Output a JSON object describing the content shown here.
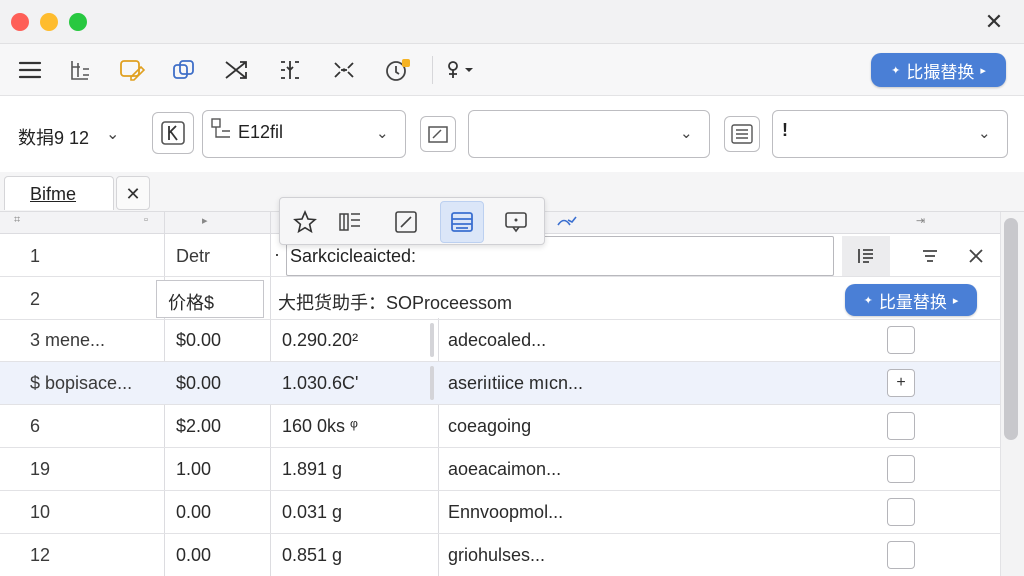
{
  "window": {
    "close_glyph": "✕"
  },
  "toolbar": {
    "icons": [
      "menu-icon",
      "list-structure-icon",
      "edit-comment-icon",
      "copy-shapes-icon",
      "shuffle-icon",
      "split-columns-icon",
      "scatter-tool-icon",
      "pin-notification-icon",
      "person-dropdown-icon"
    ],
    "batch_replace_label": "比撮替换"
  },
  "filter": {
    "label": "数捐9 12",
    "combo1_value": "E12fil",
    "combo2_value": "",
    "combo3_value": "!"
  },
  "tab": {
    "label": "Bifme",
    "close_glyph": "✕"
  },
  "grid": {
    "header_glyphs": [
      "⌗",
      "▫",
      "▸",
      "⇥"
    ],
    "row1": {
      "num": "1",
      "col2": "Detr",
      "col3_marker": "·",
      "edit_value": "Sarkciclеаіcted:"
    },
    "row2": {
      "num": "2",
      "col2": "价格$",
      "col3": "大把货助手：SOProceessom",
      "batch_replace_label": "比量替换"
    },
    "rows": [
      {
        "num": "3  mene...",
        "price": "$0.00",
        "val": "0.290.20²",
        "desc": "adecoaled...",
        "check": ""
      },
      {
        "num": "$  bopisace...",
        "price": "$0.00",
        "val": "1.030.6C'",
        "desc": "aseriıtiice mıcn...",
        "check": "+"
      },
      {
        "num": "6",
        "price": "$2.00",
        "val": "160 0ks  ᵠ",
        "desc": "coeagoing",
        "check": ""
      },
      {
        "num": "19",
        "price": "1.00",
        "val": "1.891 g",
        "desc": "aoeacaimon...",
        "check": ""
      },
      {
        "num": "10",
        "price": "0.00",
        "val": "0.031 g",
        "desc": "Ennvoopmol...",
        "check": ""
      },
      {
        "num": "12",
        "price": "0.00",
        "val": "0.851 g",
        "desc": "griohulses...",
        "check": ""
      }
    ]
  },
  "colors": {
    "accent": "#4a7fd6",
    "selected_row": "#eef2fb"
  }
}
